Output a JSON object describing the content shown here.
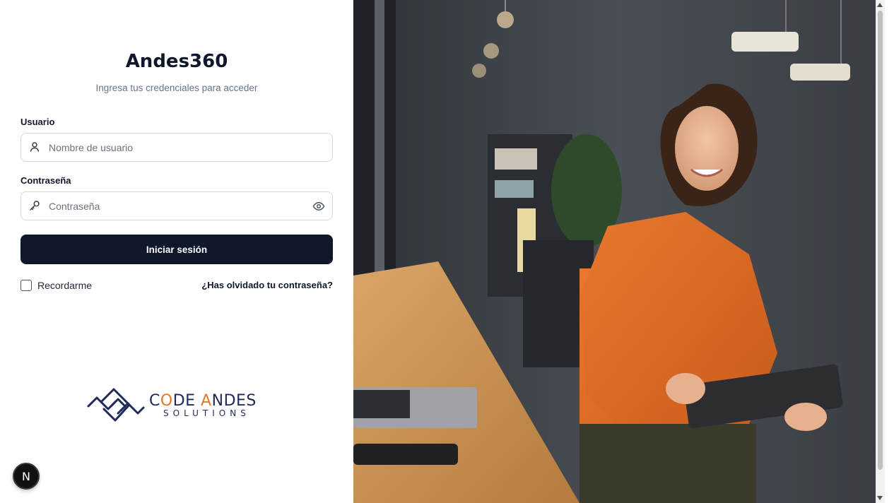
{
  "app": {
    "title": "Andes360",
    "subtitle": "Ingresa tus credenciales para acceder"
  },
  "form": {
    "username": {
      "label": "Usuario",
      "placeholder": "Nombre de usuario",
      "value": "",
      "icon": "user-icon"
    },
    "password": {
      "label": "Contraseña",
      "placeholder": "Contraseña",
      "value": "",
      "icon": "key-icon",
      "toggle_icon": "eye-icon"
    },
    "submit_label": "Iniciar sesión",
    "remember_label": "Recordarme",
    "remember_checked": false,
    "forgot_label": "¿Has olvidado tu contraseña?"
  },
  "brand": {
    "word1_prefix": "C",
    "word1_accent": "O",
    "word1_rest": "DE ",
    "word2_accent": "A",
    "word2_rest": "NDES",
    "tagline": "SOLUTIONS",
    "color_primary": "#1e2a5a",
    "color_accent": "#e07a2e"
  },
  "dev_badge": {
    "label": "N"
  },
  "hero": {
    "alt": "Mujer sonriente con tableta en oficina"
  },
  "colors": {
    "primary_button": "#0f172a",
    "muted_text": "#64748b",
    "input_border": "#d4d8de"
  }
}
